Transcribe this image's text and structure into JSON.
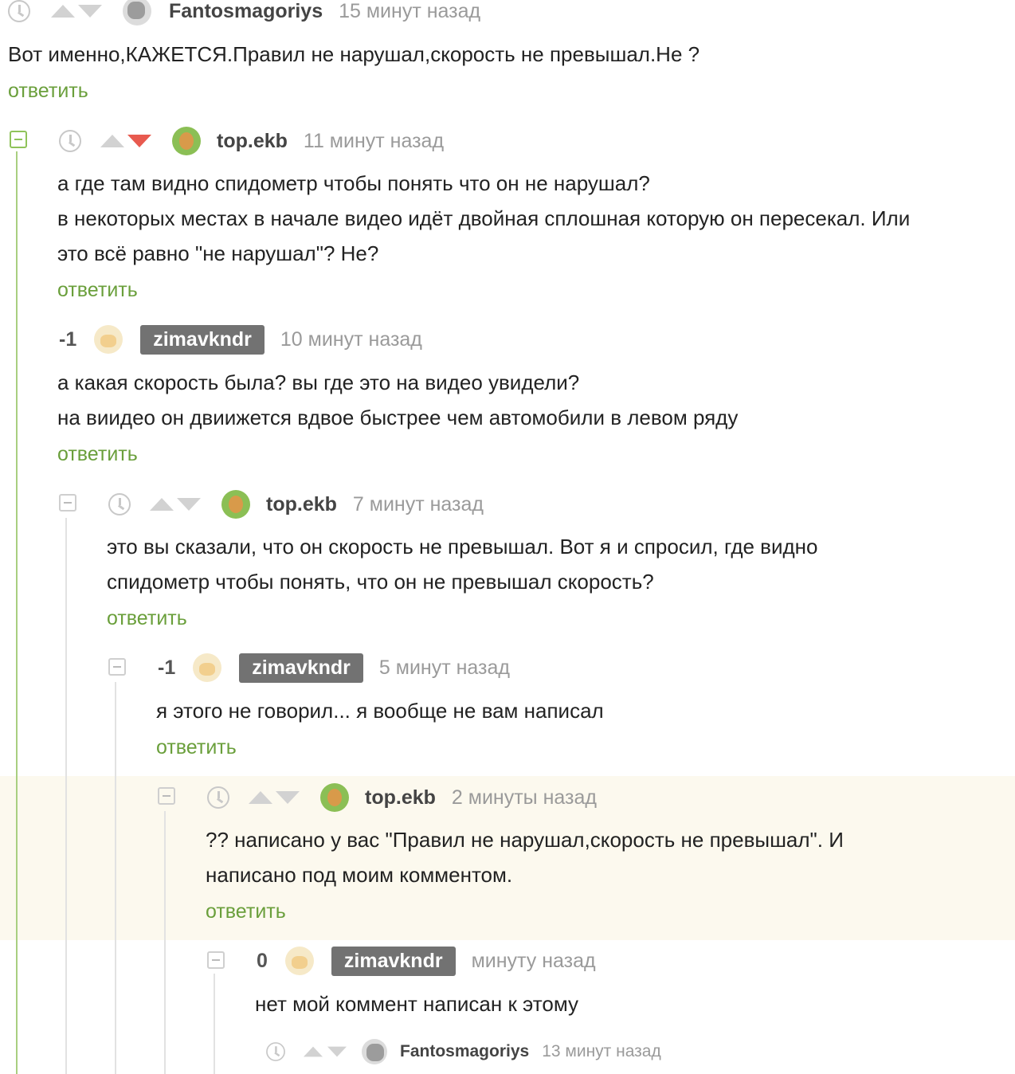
{
  "comments": [
    {
      "score": "",
      "user": "Fantosmagoriys",
      "time": "15 минут назад",
      "lines": [
        "Вот именно,КАЖЕТСЯ.Правил не нарушал,скорость не превышал.Не ?"
      ],
      "reply": "ответить"
    },
    {
      "score": "",
      "user": "top.ekb",
      "time": "11 минут назад",
      "lines": [
        "а где там видно спидометр чтобы понять что он не нарушал?",
        "в некоторых местах в начале видео идёт двойная сплошная которую он пересекал. Или",
        "это всё равно \"не нарушал\"? Не?"
      ],
      "reply": "ответить"
    },
    {
      "score": "-1",
      "user": "zimavkndr",
      "time": "10 минут назад",
      "lines": [
        "а какая скорость была? вы где это на видео увидели?",
        "на виидео он двиижется вдвое быстрее чем автомобили в левом ряду"
      ],
      "reply": "ответить"
    },
    {
      "score": "",
      "user": "top.ekb",
      "time": "7 минут назад",
      "lines": [
        "это вы сказали, что он скорость не превышал. Вот я и спросил, где видно",
        "спидометр чтобы понять, что он не превышал скорость?"
      ],
      "reply": "ответить"
    },
    {
      "score": "-1",
      "user": "zimavkndr",
      "time": "5 минут назад",
      "lines": [
        "я этого не говорил... я вообще не вам написал"
      ],
      "reply": "ответить"
    },
    {
      "score": "",
      "user": "top.ekb",
      "time": "2 минуты назад",
      "lines": [
        "?? написано у вас \"Правил не нарушал,скорость не превышал\". И",
        "написано под моим комментом."
      ],
      "reply": "ответить"
    },
    {
      "score": "0",
      "user": "zimavkndr",
      "time": "минуту назад",
      "lines": [
        "нет мой коммент написан к этому"
      ],
      "reply": ""
    },
    {
      "score": "",
      "user": "Fantosmagoriys",
      "time": "13 минут назад",
      "lines": [],
      "reply": ""
    }
  ],
  "colors": {
    "accent": "#6a9f3b",
    "downvote_active": "#e85a4f",
    "highlight": "#fcf9ee"
  }
}
